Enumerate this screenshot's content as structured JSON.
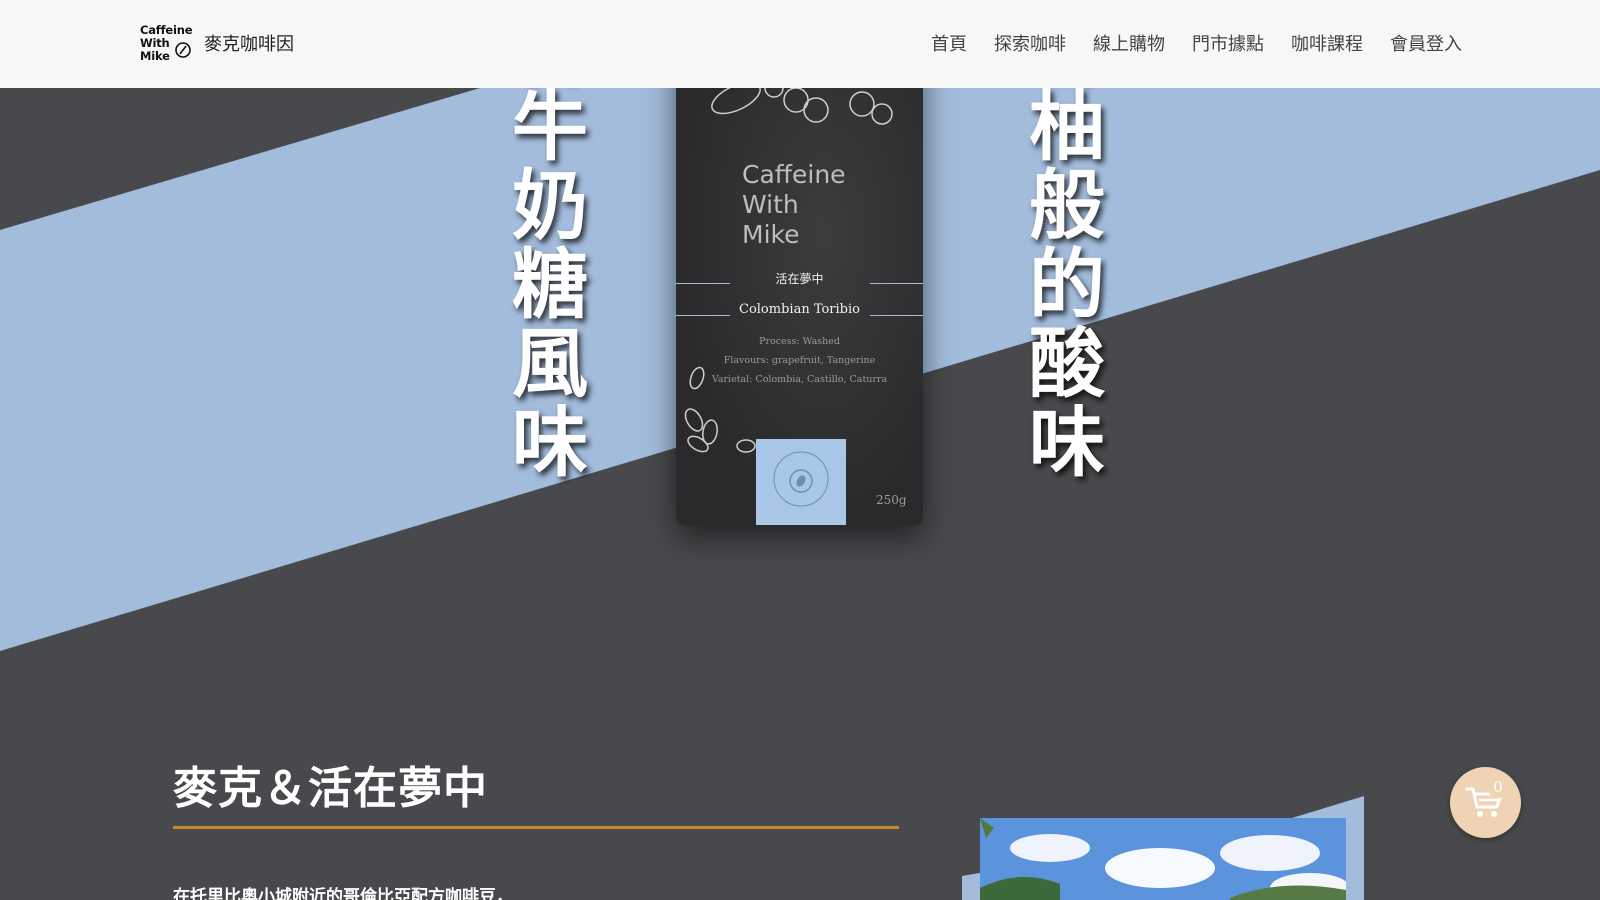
{
  "header": {
    "logo_lines": [
      "Caffeine",
      "With",
      "Mike"
    ],
    "brand_name": "麥克咖啡因",
    "nav": [
      {
        "label": "首頁"
      },
      {
        "label": "探索咖啡"
      },
      {
        "label": "線上購物"
      },
      {
        "label": "門市據點"
      },
      {
        "label": "咖啡課程"
      },
      {
        "label": "會員登入"
      }
    ]
  },
  "hero": {
    "left_vertical_text": "香牛奶糖風味",
    "right_vertical_text": "葡柚般的酸味",
    "bag": {
      "brand_lines": [
        "Caffeine",
        "With",
        "Mike"
      ],
      "name_zh": "活在夢中",
      "name_en": "Colombian Toribio",
      "process": "Process: Washed",
      "flavours": "Flavours: grapefruit, Tangerine",
      "varietal": "Varietal: Colombia, Castillo, Caturra",
      "weight": "250g"
    },
    "colors": {
      "band": "#a3bcdc",
      "dark": "#48494c"
    }
  },
  "section": {
    "title": "麥克＆活在夢中",
    "body_line": "在托里比奧小城附近的哥倫比亞配方咖啡豆，"
  },
  "cart": {
    "count": "0"
  },
  "icons": [
    "cup-logo-icon",
    "cart-icon"
  ],
  "colors": {
    "accent": "#c98a2c",
    "cart_bg": "#f0d3b4",
    "header_bg": "#f7f7f7"
  }
}
